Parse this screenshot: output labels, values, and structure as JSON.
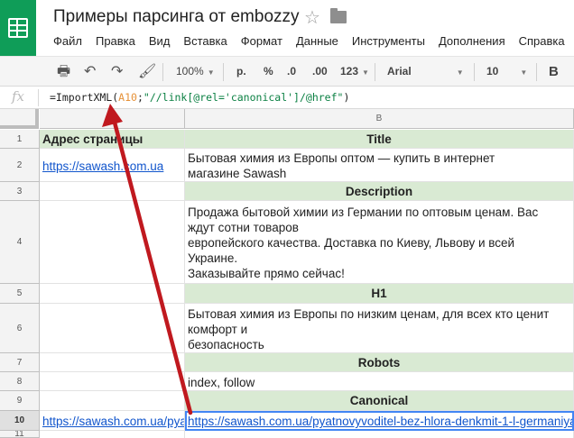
{
  "app": {
    "title": "Примеры парсинга от embozzy",
    "menu": [
      "Файл",
      "Правка",
      "Вид",
      "Вставка",
      "Формат",
      "Данные",
      "Инструменты",
      "Дополнения",
      "Справка"
    ]
  },
  "toolbar": {
    "zoom": "100%",
    "currency": "р.",
    "percent": "%",
    "decimals": ".0",
    "more_formats": "123",
    "font": "Arial",
    "font_size": "10",
    "bold": "B"
  },
  "formula_bar": {
    "fx": "fx",
    "prefix": "=ImportXML(",
    "ref": "A10",
    "sep": ";",
    "xpath": "\"//link[@rel='canonical']/@href\"",
    "suffix": ")"
  },
  "grid": {
    "columns": [
      "",
      "B"
    ],
    "rows": [
      "1",
      "2",
      "3",
      "4",
      "5",
      "6",
      "7",
      "8",
      "9",
      "10",
      "11"
    ],
    "cells": {
      "a1": "Адрес страницы",
      "b1": "Title",
      "a2": "https://sawash.com.ua",
      "b2": [
        "Бытовая химия из Европы оптом — купить в интернет",
        "магазине Sawash"
      ],
      "b3": "Description",
      "b4": [
        "Продажа бытовой химии из Германии по оптовым ценам. Вас",
        "ждут сотни товаров",
        "европейского качества. Доставка по Киеву, Львову и всей",
        "Украине.",
        "Заказывайте прямо сейчас!"
      ],
      "b5": "H1",
      "b6": [
        "Бытовая химия из Европы по низким ценам, для всех кто ценит",
        "комфорт и",
        "безопасность"
      ],
      "b7": "Robots",
      "b8": "index, follow",
      "b9": "Canonical",
      "a10": "https://sawash.com.ua/pyat",
      "b10": "https://sawash.com.ua/pyatnovyvoditel-bez-hlora-denkmit-1-l-germaniya"
    }
  },
  "colors": {
    "brand": "#0f9d58",
    "header_fill": "#d9ead3",
    "link": "#1155cc",
    "arrow": "#c0191f",
    "selection": "#4285f4"
  }
}
